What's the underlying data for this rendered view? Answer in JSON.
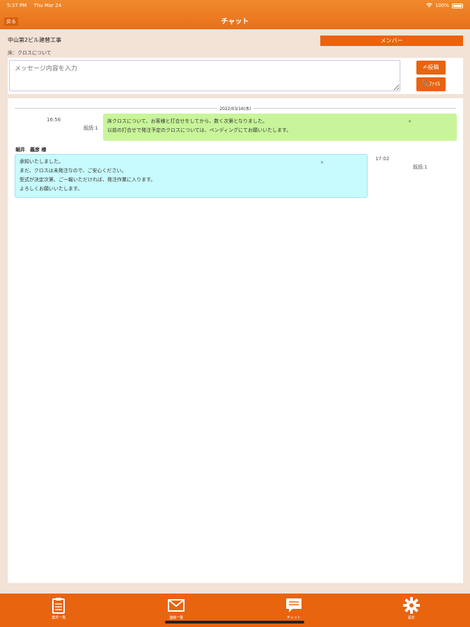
{
  "status_bar": {
    "time": "5:37 PM",
    "date": "Thu Mar 24",
    "battery": "100%",
    "wifi_icon": "wifi-icon",
    "battery_icon": "battery-icon"
  },
  "header": {
    "back_label": "戻る",
    "title": "チャット"
  },
  "project": {
    "name": "中山第2ビル建替工事",
    "member_button": "メンバー",
    "topic": "床：クロスについて"
  },
  "composer": {
    "placeholder": "メッセージ内容を入力",
    "post_label": "✍投稿",
    "file_label": "📎ﾌｧｲﾙ"
  },
  "chat": {
    "date": "2022/03/16(水)",
    "messages": [
      {
        "time": "16:56",
        "read": "既読:1",
        "lines": [
          "床クロスについて、お客様と打合せをしてから、数く次第となりました。",
          "以前の打合せで発注予定のクロスについては、ペンディングにてお願いいたします。"
        ],
        "close": "×"
      },
      {
        "sender": "堀井　義彦 様",
        "time": "17:02",
        "read": "既読:1",
        "lines": [
          "承知いたしました。",
          "まだ、クロスは未発注なので、ご安心ください。",
          "型式が決定次第、ご一報いただければ、発注作業に入ります。",
          "よろしくお願いいたします。"
        ],
        "close": "×"
      }
    ]
  },
  "tabs": [
    {
      "label": "案件一覧",
      "icon": "clipboard-icon"
    },
    {
      "label": "連絡一覧",
      "icon": "envelope-icon"
    },
    {
      "label": "チャット",
      "icon": "chat-icon"
    },
    {
      "label": "設定",
      "icon": "gear-icon"
    }
  ],
  "colors": {
    "accent": "#e8640f",
    "background": "#f3e2d6",
    "own_bubble": "#c8f59a",
    "other_bubble": "#c8fbfd"
  }
}
